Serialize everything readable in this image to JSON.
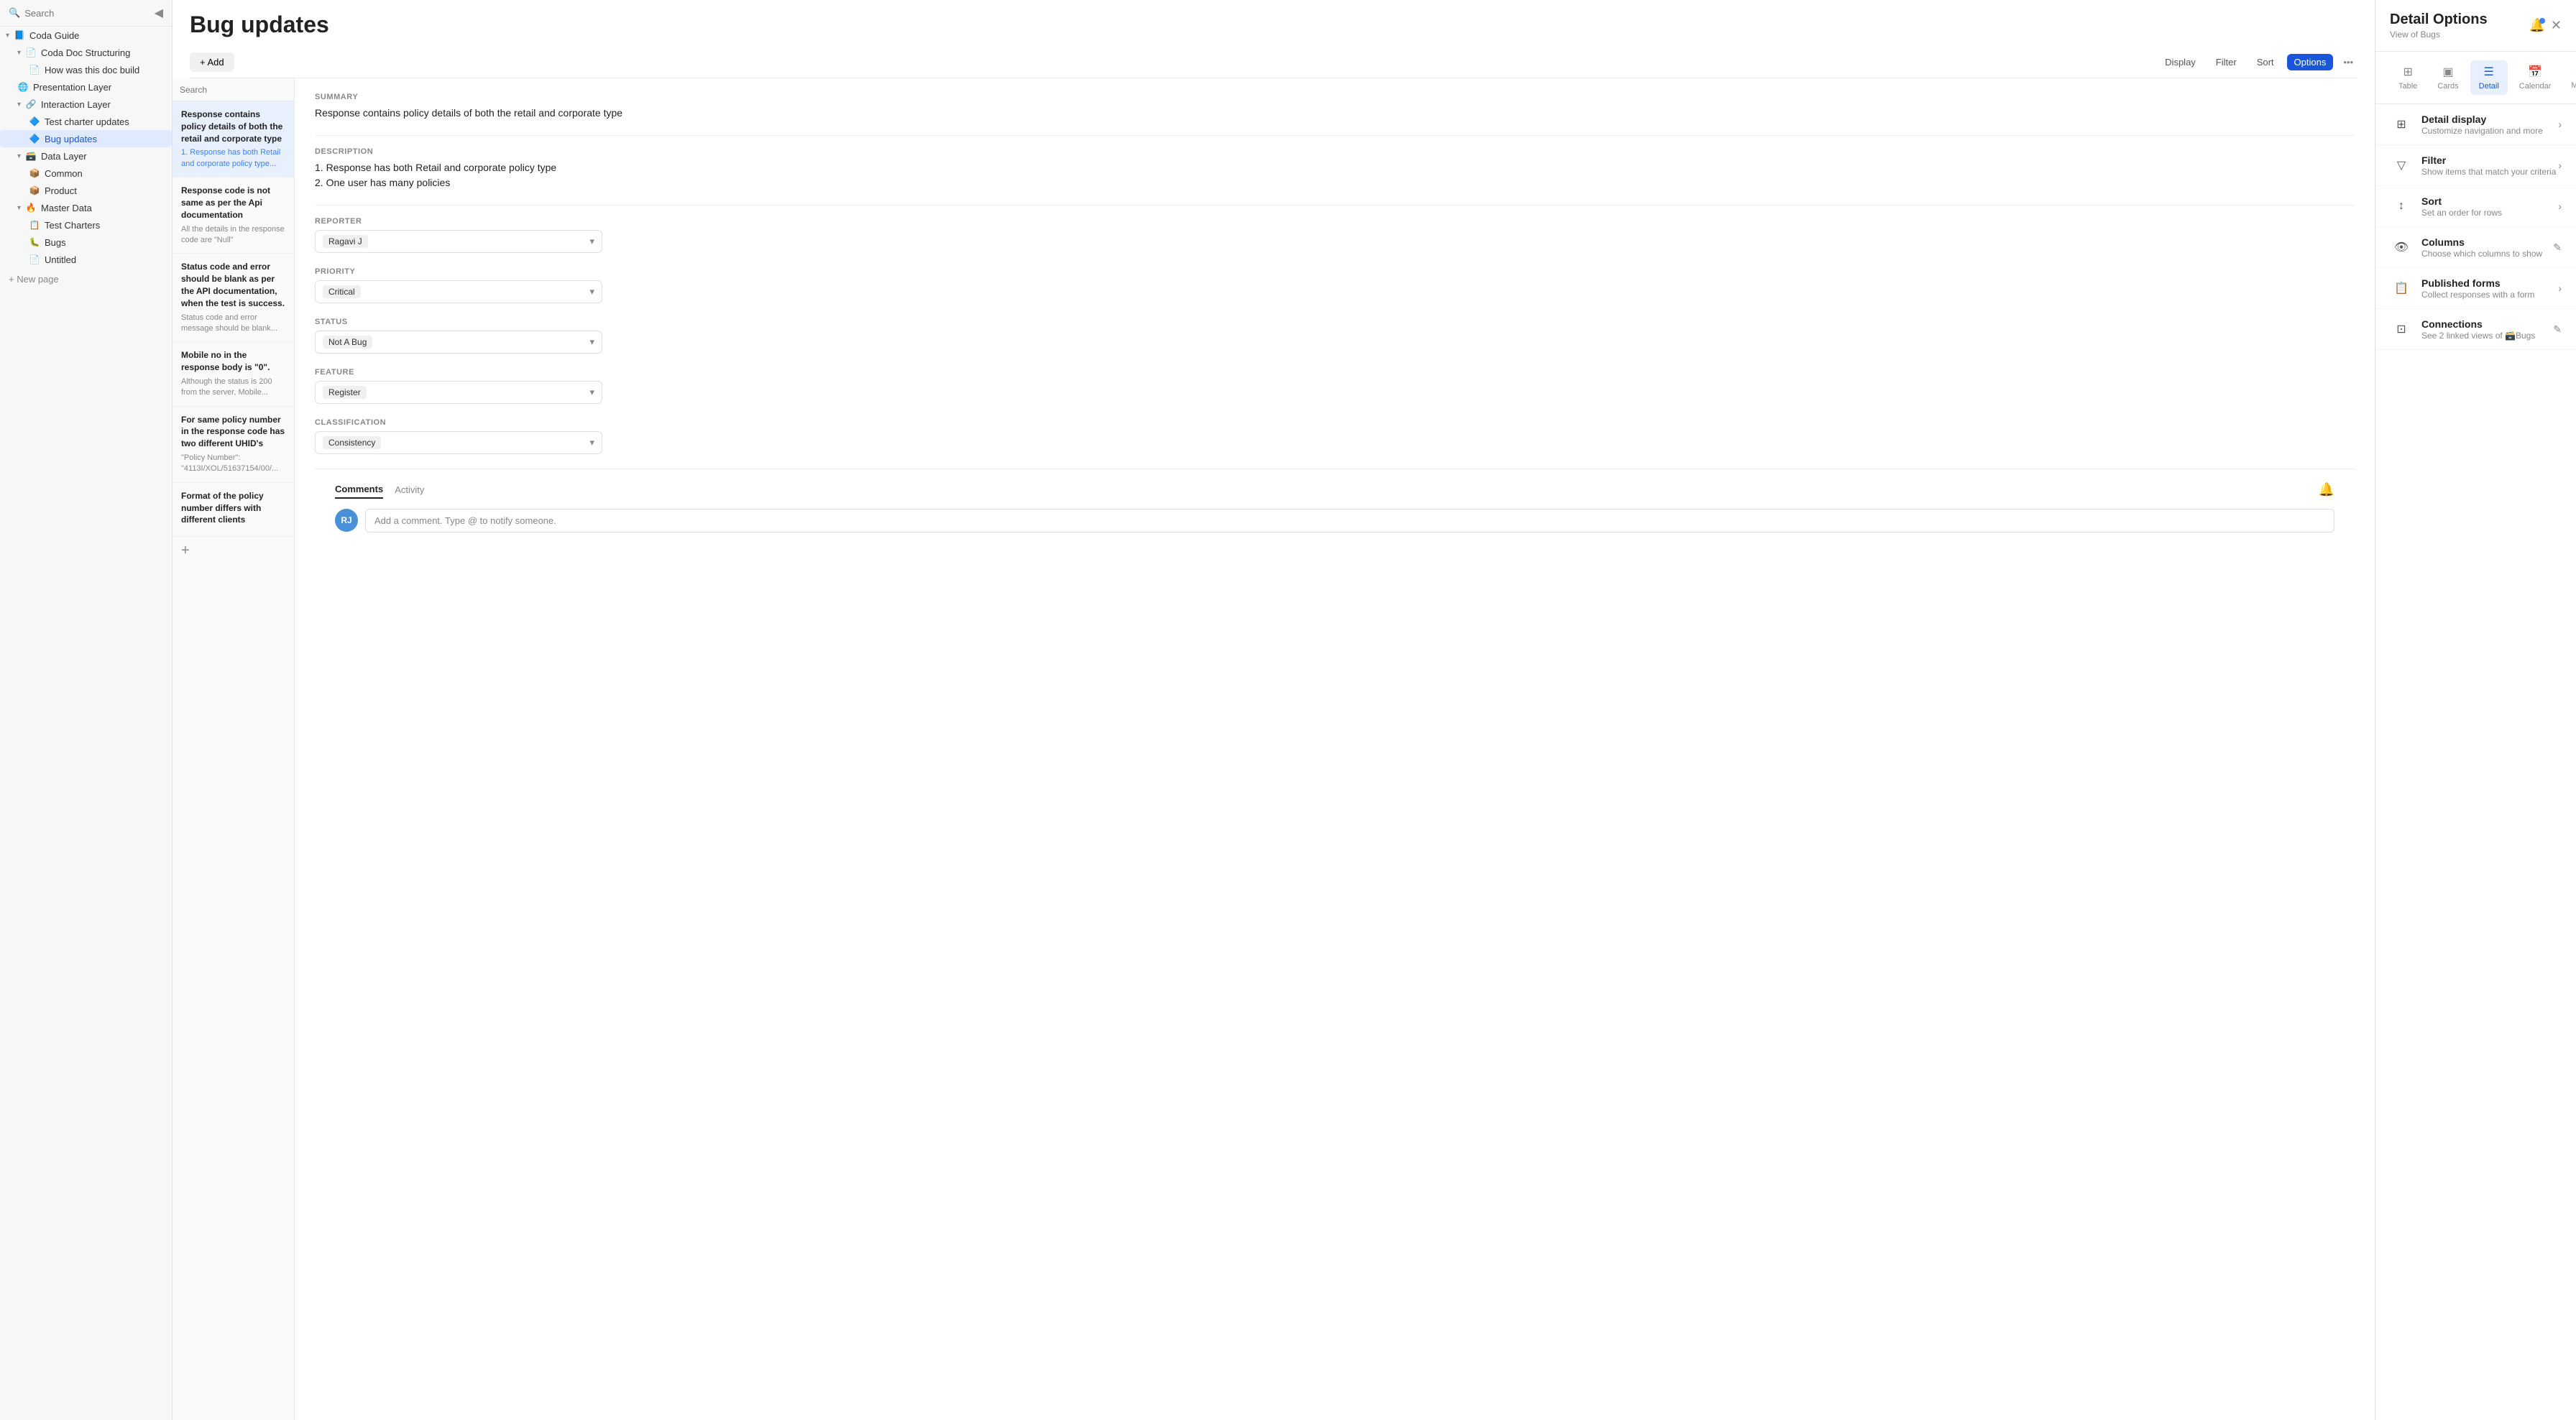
{
  "sidebar": {
    "search_placeholder": "Search",
    "collapse_icon": "◀",
    "items": [
      {
        "id": "coda-guide",
        "label": "Coda Guide",
        "indent": 0,
        "icon": "📘",
        "chevron": "▾",
        "expanded": true
      },
      {
        "id": "coda-doc-structuring",
        "label": "Coda Doc Structuring",
        "indent": 1,
        "icon": "📄",
        "chevron": "▾",
        "expanded": true
      },
      {
        "id": "how-was-this-doc-build",
        "label": "How was this doc build",
        "indent": 2,
        "icon": "📄"
      },
      {
        "id": "presentation-layer",
        "label": "Presentation Layer",
        "indent": 1,
        "icon": "🌐"
      },
      {
        "id": "interaction-layer",
        "label": "Interaction Layer",
        "indent": 1,
        "icon": "🔗",
        "chevron": "▾",
        "expanded": true
      },
      {
        "id": "test-charter-updates",
        "label": "Test charter updates",
        "indent": 2,
        "icon": "🔷"
      },
      {
        "id": "bug-updates",
        "label": "Bug updates",
        "indent": 2,
        "icon": "🔷",
        "active": true
      },
      {
        "id": "data-layer",
        "label": "Data Layer",
        "indent": 1,
        "icon": "🗃️",
        "chevron": "▾",
        "expanded": true
      },
      {
        "id": "common",
        "label": "Common",
        "indent": 2,
        "icon": "📦"
      },
      {
        "id": "product",
        "label": "Product",
        "indent": 2,
        "icon": "📦"
      },
      {
        "id": "master-data",
        "label": "Master Data",
        "indent": 1,
        "icon": "🔥",
        "chevron": "▾",
        "expanded": true
      },
      {
        "id": "test-charters",
        "label": "Test Charters",
        "indent": 2,
        "icon": "📋"
      },
      {
        "id": "bugs",
        "label": "Bugs",
        "indent": 2,
        "icon": "🐛"
      },
      {
        "id": "untitled",
        "label": "Untitled",
        "indent": 2,
        "icon": "📄"
      }
    ],
    "new_page_label": "+ New page"
  },
  "main": {
    "title": "Bug updates",
    "add_button": "+ Add",
    "toolbar_buttons": [
      "Display",
      "Filter",
      "Sort",
      "Options"
    ],
    "active_toolbar": "Options"
  },
  "bug_list": {
    "search_placeholder": "Search",
    "items": [
      {
        "id": 1,
        "title": "Response contains policy details of both the retail and corporate type",
        "desc": "1. Response has both Retail and corporate policy type...",
        "desc_color": "blue",
        "selected": true
      },
      {
        "id": 2,
        "title": "Response code is not same as per the Api documentation",
        "desc": "All the details in the response code are \"Null\"",
        "desc_color": "gray"
      },
      {
        "id": 3,
        "title": "Status code and error should be blank as per the API documentation, when the test is success.",
        "desc": "Status code and error message should be blank...",
        "desc_color": "gray"
      },
      {
        "id": 4,
        "title": "Mobile no in the response body is \"0\".",
        "desc": "Although the status is 200 from the server, Mobile...",
        "desc_color": "gray"
      },
      {
        "id": 5,
        "title": "For same policy number in the response code has two different UHID's",
        "desc": "\"Policy Number\": \"4113I/XOL/51637154/00/...",
        "desc_color": "gray"
      },
      {
        "id": 6,
        "title": "Format of the policy number differs with different clients",
        "desc": "",
        "desc_color": "gray"
      }
    ]
  },
  "detail": {
    "summary_label": "SUMMARY",
    "summary_value": "Response contains policy details of both the retail and corporate type",
    "description_label": "DESCRIPTION",
    "description_lines": [
      "1. Response has both Retail and corporate policy type",
      "2. One user has many policies"
    ],
    "reporter_label": "REPORTER",
    "reporter_value": "Ragavi J",
    "priority_label": "PRIORITY",
    "priority_value": "Critical",
    "status_label": "STATUS",
    "status_value": "Not A Bug",
    "feature_label": "FEATURE",
    "feature_value": "Register",
    "classification_label": "CLASSIFICATION",
    "classification_value": "Consistency"
  },
  "comments": {
    "tabs": [
      "Comments",
      "Activity"
    ],
    "active_tab": "Comments",
    "input_placeholder": "Add a comment. Type @ to notify someone.",
    "avatar_initials": "RJ"
  },
  "options_panel": {
    "title": "Detail Options",
    "subtitle": "View of Bugs",
    "view_tabs": [
      {
        "id": "table",
        "label": "Table",
        "icon": "⊞"
      },
      {
        "id": "cards",
        "label": "Cards",
        "icon": "▣"
      },
      {
        "id": "detail",
        "label": "Detail",
        "icon": "☰",
        "active": true
      },
      {
        "id": "calendar",
        "label": "Calendar",
        "icon": "📅"
      },
      {
        "id": "more",
        "label": "More",
        "icon": "•••"
      }
    ],
    "options": [
      {
        "id": "detail-display",
        "name": "Detail display",
        "desc": "Customize navigation and more",
        "icon": "⊞",
        "action": "chevron"
      },
      {
        "id": "filter",
        "name": "Filter",
        "desc": "Show items that match your criteria",
        "icon": "▽",
        "action": "chevron"
      },
      {
        "id": "sort",
        "name": "Sort",
        "desc": "Set an order for rows",
        "icon": "↕",
        "action": "chevron"
      },
      {
        "id": "columns",
        "name": "Columns",
        "desc": "Choose which columns to show",
        "icon": "👁",
        "action": "edit"
      },
      {
        "id": "published-forms",
        "name": "Published forms",
        "desc": "Collect responses with a form",
        "icon": "📋",
        "action": "chevron"
      },
      {
        "id": "connections",
        "name": "Connections",
        "desc": "See 2 linked views of 🗃️Bugs",
        "icon": "⊡",
        "action": "edit"
      }
    ]
  }
}
